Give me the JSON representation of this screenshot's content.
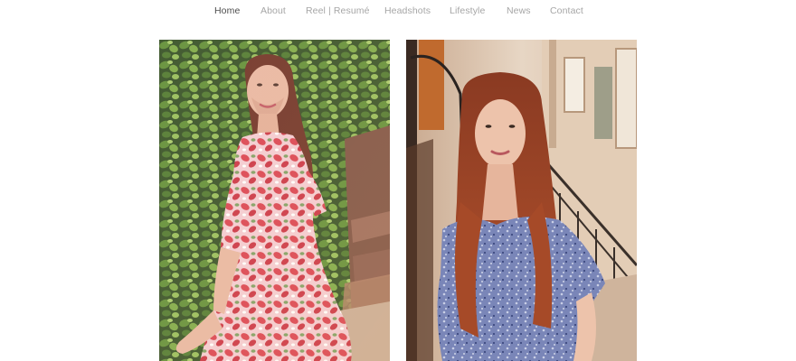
{
  "nav": {
    "items": [
      {
        "label": "Home",
        "active": true
      },
      {
        "label": "About",
        "active": false
      },
      {
        "label": "Reel | Resumé",
        "active": false
      },
      {
        "label": "Headshots",
        "active": false
      },
      {
        "label": "Lifestyle",
        "active": false
      },
      {
        "label": "News",
        "active": false
      },
      {
        "label": "Contact",
        "active": false
      }
    ]
  },
  "photos": [
    {
      "icon": "portrait-photo-red-floral-dress"
    },
    {
      "icon": "portrait-photo-blue-dress-street"
    }
  ],
  "colors": {
    "nav_active": "#4d4d4d",
    "nav_inactive": "#a6a6a6",
    "background": "#ffffff"
  }
}
